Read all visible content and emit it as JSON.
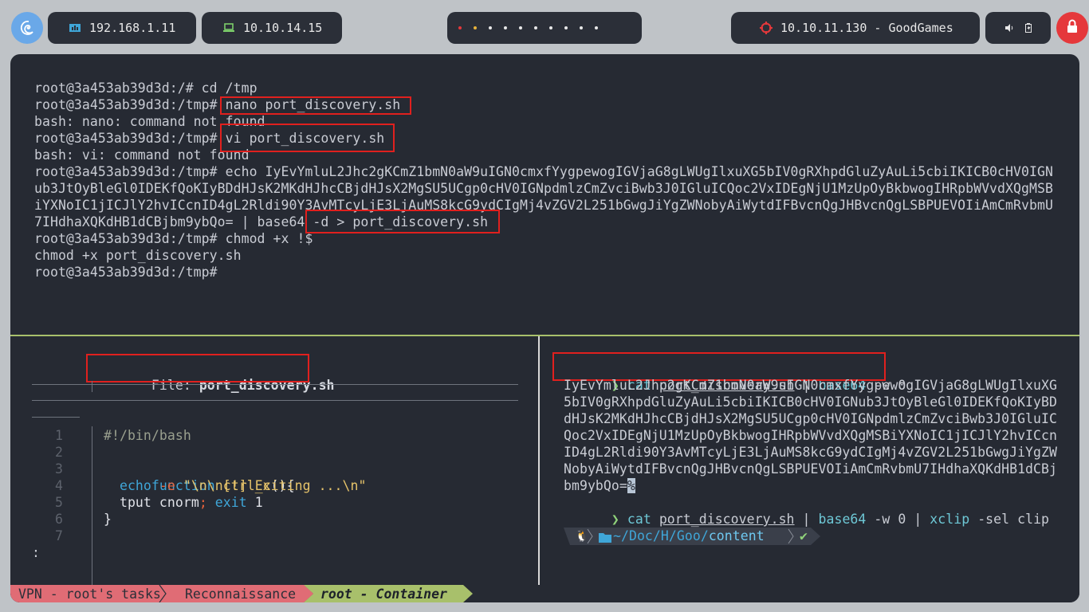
{
  "topbar": {
    "host_ip": "192.168.1.11",
    "vpn_ip": "10.10.14.15",
    "target": "10.10.11.130 - GoodGames",
    "workspaces": 10
  },
  "top_pane": {
    "lines": [
      "root@3a453ab39d3d:/# cd /tmp",
      "root@3a453ab39d3d:/tmp# nano port_discovery.sh",
      "bash: nano: command not found",
      "root@3a453ab39d3d:/tmp# vi port_discovery.sh",
      "bash: vi: command not found",
      "root@3a453ab39d3d:/tmp# echo IyEvYmluL2Jhc2gKCmZ1bmN0aW9uIGN0cmxfYygpewogIGVjaG8gLWUgIlxuXG5bIV0gRXhpdGluZyAuLi5cbiIKICB0cHV0IGN",
      "ub3JtOyBleGl0IDEKfQoKIyBDdHJsK2MKdHJhcCBjdHJsX2MgSU5UCgp0cHV0IGNpdmlzCmZvciBwb3J0IGluICQoc2VxIDEgNjU1MzUpOyBkbwogIHRpbWVvdXQgMSB",
      "iYXNoIC1jICJlY2hvICcnID4gL2Rldi90Y3AvMTcyLjE3LjAuMS8kcG9ydCIgMj4vZGV2L251bGwgJiYgZWNobyAiWytdIFBvcnQgJHBvcnQgLSBPUEVOIiAmCmRvbmU",
      "7IHdhaXQKdHB1dCBjbm9ybQo= | base64 -d > port_discovery.sh",
      "root@3a453ab39d3d:/tmp# chmod +x !$",
      "chmod +x port_discovery.sh",
      "root@3a453ab39d3d:/tmp# "
    ]
  },
  "left_pane": {
    "file_label": "File: ",
    "file_name": "port_discovery.sh",
    "line_numbers": [
      "1",
      "2",
      "3",
      "4",
      "5",
      "6",
      "7"
    ],
    "code": {
      "shebang": "#!/bin/bash",
      "l3_kw": "function",
      "l3_fn": "ctrl_c",
      "l3_rest": "(){",
      "l4_cmd": "echo",
      "l4_flag": "-e",
      "l4_str": "\"\\n\\n[!] Exiting ...\\n\"",
      "l5_a": "tput cnorm",
      "l5_semi": ";",
      "l5_exit": "exit",
      "l5_num": "1",
      "l6": "}"
    },
    "pager_prompt": ":"
  },
  "right_pane": {
    "cmd1": {
      "arrow": "❯",
      "cmd": "cat",
      "arg": "port_discovery.sh",
      "pipe": "|",
      "cmd2": "base64",
      "flags": "-w 0"
    },
    "output": [
      "IyEvYmluL2Jhc2gKCmZ1bmN0aW9uIGN0cmxfYygpewogIGVjaG8gLWUgIlxuXG",
      "5bIV0gRXhpdGluZyAuLi5cbiIKICB0cHV0IGNub3JtOyBleGl0IDEKfQoKIyBD",
      "dHJsK2MKdHJhcCBjdHJsX2MgSU5UCgp0cHV0IGNpdmlzCmZvciBwb3J0IGluIC",
      "Qoc2VxIDEgNjU1MzUpOyBkbwogIHRpbWVvdXQgMSBiYXNoIC1jICJlY2hvICcn",
      "ID4gL2Rldi90Y3AvMTcyLjE3LjAuMS8kcG9ydCIgMj4vZGV2L251bGwgJiYgZW",
      "NobyAiWytdIFBvcnQgJHBvcnQgLSBPUEVOIiAmCmRvbmU7IHdhaXQKdHB1dCBj",
      "bm9ybQo="
    ],
    "cursor_glyph": "%",
    "cmd2": {
      "arrow": "❯",
      "cmd": "cat",
      "arg": "port_discovery.sh",
      "pipe": "|",
      "cmd2": "base64",
      "flags": "-w 0",
      "pipe2": "|",
      "cmd3": "xclip",
      "flags2": "-sel clip"
    },
    "prompt": {
      "os_glyph": "🐧",
      "path_prefix": "~/Doc/H/Goo/",
      "path_dir": "content",
      "check": "✔"
    }
  },
  "statusbar": {
    "tab1": "VPN - root's tasks",
    "tab2": "Reconnaissance",
    "tab3": "root - Container"
  },
  "colors": {
    "terminal_bg": "#262a33",
    "accent_green": "#a8c06b",
    "status_red": "#e06c75",
    "highlight_box": "#e0201e"
  }
}
